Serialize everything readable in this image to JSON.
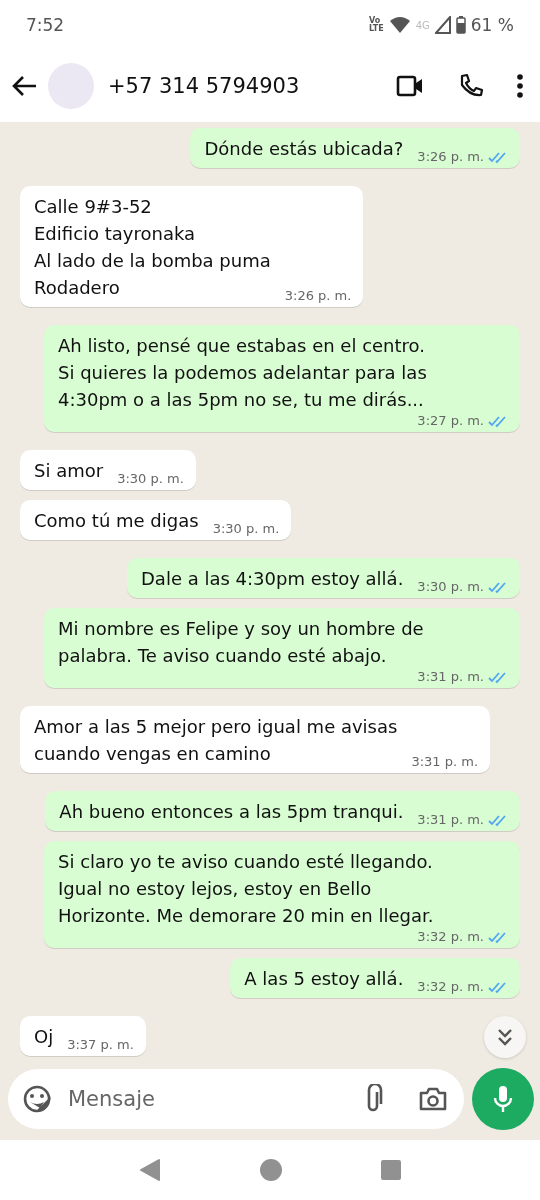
{
  "status_bar": {
    "time": "7:52",
    "network_badge": "Vo\nLTE",
    "network_type": "4G",
    "battery": "61 %"
  },
  "header": {
    "contact": "+57 314 5794903"
  },
  "messages": [
    {
      "kind": "sent",
      "text": "Dónde estás ubicada?",
      "time": "3:26 p. m.",
      "read": true
    },
    {
      "kind": "received",
      "text": "Calle 9#3-52\nEdificio tayronaka\nAl lado de la bomba puma\nRodadero",
      "time": "3:26 p. m."
    },
    {
      "kind": "sent",
      "text": "Ah listo, pensé que estabas en el centro.\nSi quieres la podemos adelantar para las\n4:30pm o a las 5pm no se, tu me dirás...",
      "time": "3:27 p. m.",
      "read": true
    },
    {
      "kind": "received",
      "text": "Si amor",
      "time": "3:30 p. m."
    },
    {
      "kind": "received",
      "text": "Como tú me digas",
      "time": "3:30 p. m."
    },
    {
      "kind": "sent",
      "text": "Dale a las 4:30pm estoy allá.",
      "time": "3:30 p. m.",
      "read": true
    },
    {
      "kind": "sent",
      "text": "Mi nombre es Felipe y soy un hombre de\npalabra. Te aviso cuando esté abajo.",
      "time": "3:31 p. m.",
      "read": true
    },
    {
      "kind": "received",
      "text": "Amor a las 5 mejor pero igual me avisas\ncuando vengas en camino",
      "time": "3:31 p. m."
    },
    {
      "kind": "sent",
      "text": "Ah bueno entonces a las 5pm tranqui.",
      "time": "3:31 p. m.",
      "read": true
    },
    {
      "kind": "sent",
      "text": "Si claro yo te aviso cuando esté llegando.\nIgual no estoy lejos, estoy en Bello\nHorizonte. Me demorare 20 min en llegar.",
      "time": "3:32 p. m.",
      "read": true
    },
    {
      "kind": "sent",
      "text": "A las 5 estoy allá.",
      "time": "3:32 p. m.",
      "read": true
    },
    {
      "kind": "received",
      "text": "Oj",
      "time": "3:37 p. m."
    }
  ],
  "composer": {
    "placeholder": "Mensaje"
  }
}
